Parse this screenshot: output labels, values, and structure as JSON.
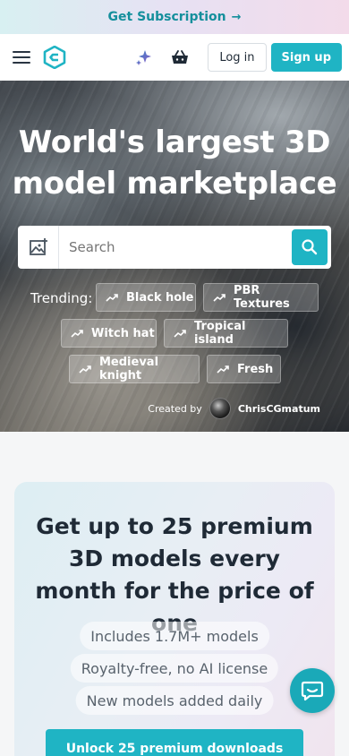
{
  "promo": {
    "label": "Get Subscription",
    "arrow": "→"
  },
  "header": {
    "login_label": "Log in",
    "signup_label": "Sign up"
  },
  "hero": {
    "title": "World's largest 3D model marketplace",
    "search_placeholder": "Search",
    "trending_label": "Trending:",
    "trending": [
      "Black hole",
      "PBR Textures",
      "Witch hat",
      "Tropical island",
      "Medieval knight",
      "Fresh"
    ],
    "credit_prefix": "Created by",
    "credit_author": "ChrisCGmatum"
  },
  "subscription_card": {
    "title": "Get up to 25 premium 3D models every month for the price of one",
    "features": [
      "Includes 1.7M+ models",
      "Royalty-free, no AI license",
      "New models added daily"
    ],
    "cta_label": "Unlock 25 premium downloads"
  },
  "colors": {
    "accent": "#1fb4c4",
    "promo_text": "#148f9c"
  },
  "icons": [
    "hamburger-menu-icon",
    "logo-icon",
    "sparkle-ai-icon",
    "basket-icon",
    "image-search-icon",
    "search-icon",
    "trending-icon",
    "chat-icon"
  ]
}
